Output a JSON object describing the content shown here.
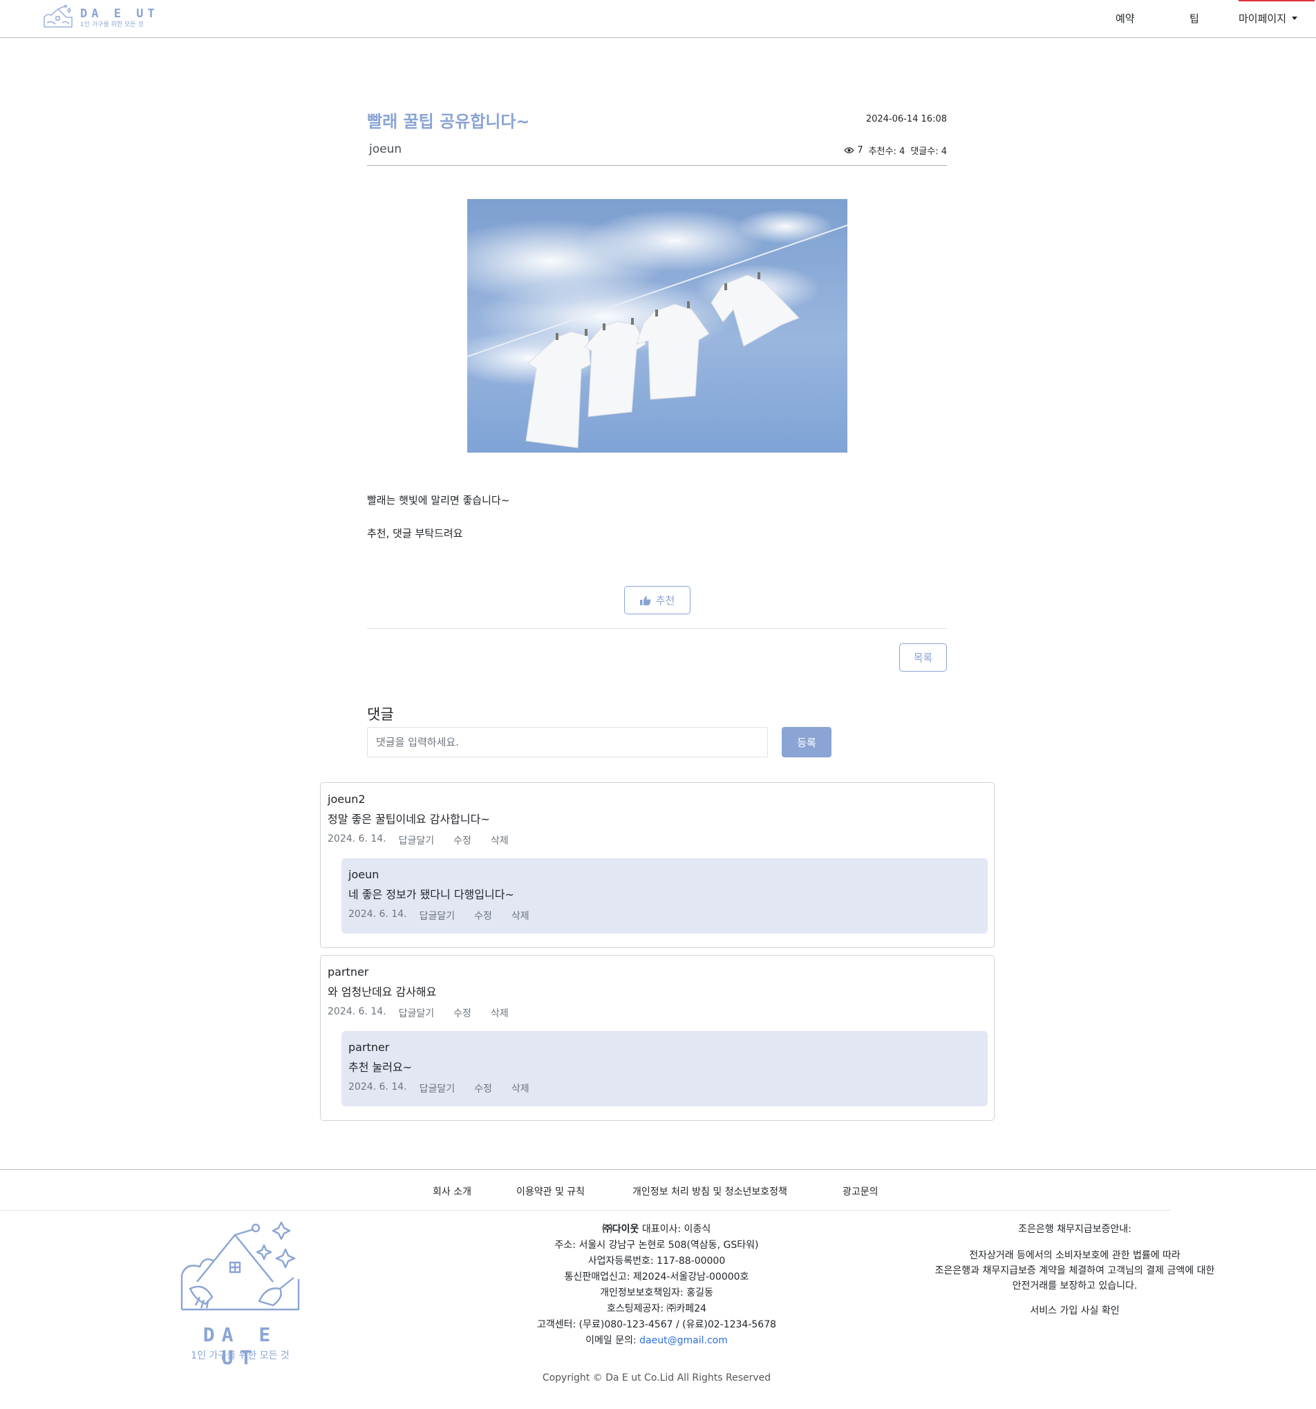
{
  "header": {
    "logo_title": "DA E UT",
    "logo_sub": "1인 가구를 위한 모든 것",
    "nav": {
      "reserve": "예약",
      "tip": "팁",
      "mypage": "마이페이지"
    }
  },
  "post": {
    "title": "빨래 꿀팁 공유합니다~",
    "date": "2024-06-14 16:08",
    "author": "joeun",
    "views": "7",
    "recommend_label": "추천수: 4",
    "comment_count_label": "댓글수: 4",
    "body_line1": "빨래는 햇빛에 말리면 좋습니다~",
    "body_line2": "추천, 댓글 부탁드려요",
    "recommend_button": "추천",
    "list_button": "목록"
  },
  "comment_form": {
    "heading": "댓글",
    "placeholder": "댓글을 입력하세요.",
    "submit": "등록"
  },
  "comment_actions": {
    "reply": "답글달기",
    "edit": "수정",
    "delete": "삭제"
  },
  "comments": [
    {
      "author": "joeun2",
      "text": "정말 좋은 꿀팁이네요 감사합니다~",
      "date": "2024. 6. 14.",
      "reply": {
        "author": "joeun",
        "text": "네 좋은 정보가 됐다니 다행입니다~",
        "date": "2024. 6. 14."
      }
    },
    {
      "author": "partner",
      "text": "와 엄청난데요 감사해요",
      "date": "2024. 6. 14.",
      "reply": {
        "author": "partner",
        "text": "추천 눌러요~",
        "date": "2024. 6. 14."
      }
    }
  ],
  "footer": {
    "links": [
      "회사 소개",
      "이용약관 및 규칙",
      "개인정보 처리 방침 및 청소년보호정책",
      "광고문의"
    ],
    "logo_title": "DA E UT",
    "logo_sub": "1인 가구를 위한 모든 것",
    "company_name": "㈜다이웃",
    "ceo": " 대표이사: 이종식",
    "address": "주소: 서울시 강남구 논현로 508(역삼동, GS타워)",
    "biz_no": "사업자등록번호: 117-88-00000",
    "mail_order": "통신판매업신고: 제2024-서울강남-00000호",
    "privacy_officer": "개인정보보호책임자: 홍길동",
    "hosting": "호스팅제공자: ㈜카페24",
    "customer_center": "고객센터: (무료)080-123-4567 / (유료)02-1234-5678",
    "email_label": "이메일 문의: ",
    "email": "daeut@gmail.com",
    "guarantee_title": "조은은행 채무지급보증안내:",
    "guarantee_line1": "전자상거래 등에서의 소비자보호에 관한 법률에 따라",
    "guarantee_line2": "조은은행과 채무지급보증 계약을 체결하여 고객님의 결제 금액에 대한",
    "guarantee_line3": "안전거래를 보장하고 있습니다.",
    "service_check": "서비스 가입 사실 확인",
    "copyright": "Copyright © Da E ut Co.Lid All Rights Reserved"
  },
  "colors": {
    "accent": "#8aa4d4",
    "reply_bg": "#e3e7f3",
    "link": "#2a6fdb"
  }
}
